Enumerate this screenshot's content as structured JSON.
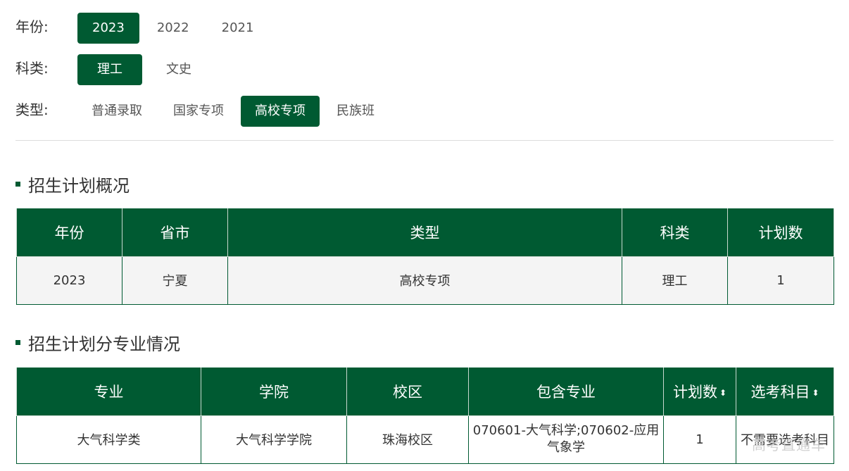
{
  "filters": {
    "year": {
      "label": "年份:",
      "options": [
        "2023",
        "2022",
        "2021"
      ],
      "selected": "2023"
    },
    "subject": {
      "label": "科类:",
      "options": [
        "理工",
        "文史"
      ],
      "selected": "理工"
    },
    "type": {
      "label": "类型:",
      "options": [
        "普通录取",
        "国家专项",
        "高校专项",
        "民族班"
      ],
      "selected": "高校专项"
    }
  },
  "overview": {
    "title": "招生计划概况",
    "headers": [
      "年份",
      "省市",
      "类型",
      "科类",
      "计划数"
    ],
    "row": [
      "2023",
      "宁夏",
      "高校专项",
      "理工",
      "1"
    ]
  },
  "majors": {
    "title": "招生计划分专业情况",
    "headers": [
      "专业",
      "学院",
      "校区",
      "包含专业",
      "计划数",
      "选考科目"
    ],
    "sort_icon": "⬍",
    "row": [
      "大气科学类",
      "大气科学学院",
      "珠海校区",
      "070601-大气科学;070602-应用气象学",
      "1",
      "不需要选考科目"
    ]
  },
  "watermark": "高考直通车",
  "colors": {
    "accent": "#005a32"
  }
}
